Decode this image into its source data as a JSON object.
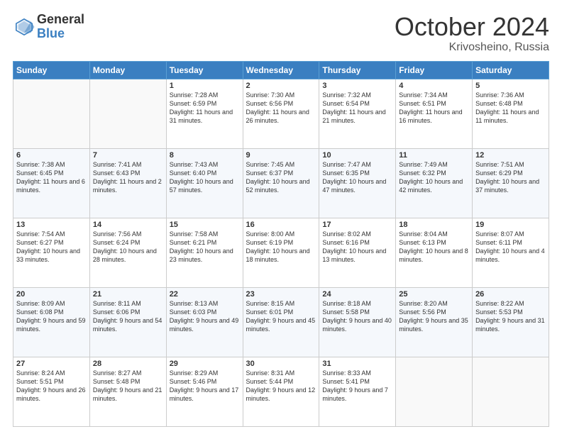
{
  "header": {
    "logo_general": "General",
    "logo_blue": "Blue",
    "month": "October 2024",
    "location": "Krivosheino, Russia"
  },
  "days_of_week": [
    "Sunday",
    "Monday",
    "Tuesday",
    "Wednesday",
    "Thursday",
    "Friday",
    "Saturday"
  ],
  "weeks": [
    [
      {
        "day": "",
        "sunrise": "",
        "sunset": "",
        "daylight": ""
      },
      {
        "day": "",
        "sunrise": "",
        "sunset": "",
        "daylight": ""
      },
      {
        "day": "1",
        "sunrise": "Sunrise: 7:28 AM",
        "sunset": "Sunset: 6:59 PM",
        "daylight": "Daylight: 11 hours and 31 minutes."
      },
      {
        "day": "2",
        "sunrise": "Sunrise: 7:30 AM",
        "sunset": "Sunset: 6:56 PM",
        "daylight": "Daylight: 11 hours and 26 minutes."
      },
      {
        "day": "3",
        "sunrise": "Sunrise: 7:32 AM",
        "sunset": "Sunset: 6:54 PM",
        "daylight": "Daylight: 11 hours and 21 minutes."
      },
      {
        "day": "4",
        "sunrise": "Sunrise: 7:34 AM",
        "sunset": "Sunset: 6:51 PM",
        "daylight": "Daylight: 11 hours and 16 minutes."
      },
      {
        "day": "5",
        "sunrise": "Sunrise: 7:36 AM",
        "sunset": "Sunset: 6:48 PM",
        "daylight": "Daylight: 11 hours and 11 minutes."
      }
    ],
    [
      {
        "day": "6",
        "sunrise": "Sunrise: 7:38 AM",
        "sunset": "Sunset: 6:45 PM",
        "daylight": "Daylight: 11 hours and 6 minutes."
      },
      {
        "day": "7",
        "sunrise": "Sunrise: 7:41 AM",
        "sunset": "Sunset: 6:43 PM",
        "daylight": "Daylight: 11 hours and 2 minutes."
      },
      {
        "day": "8",
        "sunrise": "Sunrise: 7:43 AM",
        "sunset": "Sunset: 6:40 PM",
        "daylight": "Daylight: 10 hours and 57 minutes."
      },
      {
        "day": "9",
        "sunrise": "Sunrise: 7:45 AM",
        "sunset": "Sunset: 6:37 PM",
        "daylight": "Daylight: 10 hours and 52 minutes."
      },
      {
        "day": "10",
        "sunrise": "Sunrise: 7:47 AM",
        "sunset": "Sunset: 6:35 PM",
        "daylight": "Daylight: 10 hours and 47 minutes."
      },
      {
        "day": "11",
        "sunrise": "Sunrise: 7:49 AM",
        "sunset": "Sunset: 6:32 PM",
        "daylight": "Daylight: 10 hours and 42 minutes."
      },
      {
        "day": "12",
        "sunrise": "Sunrise: 7:51 AM",
        "sunset": "Sunset: 6:29 PM",
        "daylight": "Daylight: 10 hours and 37 minutes."
      }
    ],
    [
      {
        "day": "13",
        "sunrise": "Sunrise: 7:54 AM",
        "sunset": "Sunset: 6:27 PM",
        "daylight": "Daylight: 10 hours and 33 minutes."
      },
      {
        "day": "14",
        "sunrise": "Sunrise: 7:56 AM",
        "sunset": "Sunset: 6:24 PM",
        "daylight": "Daylight: 10 hours and 28 minutes."
      },
      {
        "day": "15",
        "sunrise": "Sunrise: 7:58 AM",
        "sunset": "Sunset: 6:21 PM",
        "daylight": "Daylight: 10 hours and 23 minutes."
      },
      {
        "day": "16",
        "sunrise": "Sunrise: 8:00 AM",
        "sunset": "Sunset: 6:19 PM",
        "daylight": "Daylight: 10 hours and 18 minutes."
      },
      {
        "day": "17",
        "sunrise": "Sunrise: 8:02 AM",
        "sunset": "Sunset: 6:16 PM",
        "daylight": "Daylight: 10 hours and 13 minutes."
      },
      {
        "day": "18",
        "sunrise": "Sunrise: 8:04 AM",
        "sunset": "Sunset: 6:13 PM",
        "daylight": "Daylight: 10 hours and 8 minutes."
      },
      {
        "day": "19",
        "sunrise": "Sunrise: 8:07 AM",
        "sunset": "Sunset: 6:11 PM",
        "daylight": "Daylight: 10 hours and 4 minutes."
      }
    ],
    [
      {
        "day": "20",
        "sunrise": "Sunrise: 8:09 AM",
        "sunset": "Sunset: 6:08 PM",
        "daylight": "Daylight: 9 hours and 59 minutes."
      },
      {
        "day": "21",
        "sunrise": "Sunrise: 8:11 AM",
        "sunset": "Sunset: 6:06 PM",
        "daylight": "Daylight: 9 hours and 54 minutes."
      },
      {
        "day": "22",
        "sunrise": "Sunrise: 8:13 AM",
        "sunset": "Sunset: 6:03 PM",
        "daylight": "Daylight: 9 hours and 49 minutes."
      },
      {
        "day": "23",
        "sunrise": "Sunrise: 8:15 AM",
        "sunset": "Sunset: 6:01 PM",
        "daylight": "Daylight: 9 hours and 45 minutes."
      },
      {
        "day": "24",
        "sunrise": "Sunrise: 8:18 AM",
        "sunset": "Sunset: 5:58 PM",
        "daylight": "Daylight: 9 hours and 40 minutes."
      },
      {
        "day": "25",
        "sunrise": "Sunrise: 8:20 AM",
        "sunset": "Sunset: 5:56 PM",
        "daylight": "Daylight: 9 hours and 35 minutes."
      },
      {
        "day": "26",
        "sunrise": "Sunrise: 8:22 AM",
        "sunset": "Sunset: 5:53 PM",
        "daylight": "Daylight: 9 hours and 31 minutes."
      }
    ],
    [
      {
        "day": "27",
        "sunrise": "Sunrise: 8:24 AM",
        "sunset": "Sunset: 5:51 PM",
        "daylight": "Daylight: 9 hours and 26 minutes."
      },
      {
        "day": "28",
        "sunrise": "Sunrise: 8:27 AM",
        "sunset": "Sunset: 5:48 PM",
        "daylight": "Daylight: 9 hours and 21 minutes."
      },
      {
        "day": "29",
        "sunrise": "Sunrise: 8:29 AM",
        "sunset": "Sunset: 5:46 PM",
        "daylight": "Daylight: 9 hours and 17 minutes."
      },
      {
        "day": "30",
        "sunrise": "Sunrise: 8:31 AM",
        "sunset": "Sunset: 5:44 PM",
        "daylight": "Daylight: 9 hours and 12 minutes."
      },
      {
        "day": "31",
        "sunrise": "Sunrise: 8:33 AM",
        "sunset": "Sunset: 5:41 PM",
        "daylight": "Daylight: 9 hours and 7 minutes."
      },
      {
        "day": "",
        "sunrise": "",
        "sunset": "",
        "daylight": ""
      },
      {
        "day": "",
        "sunrise": "",
        "sunset": "",
        "daylight": ""
      }
    ]
  ]
}
